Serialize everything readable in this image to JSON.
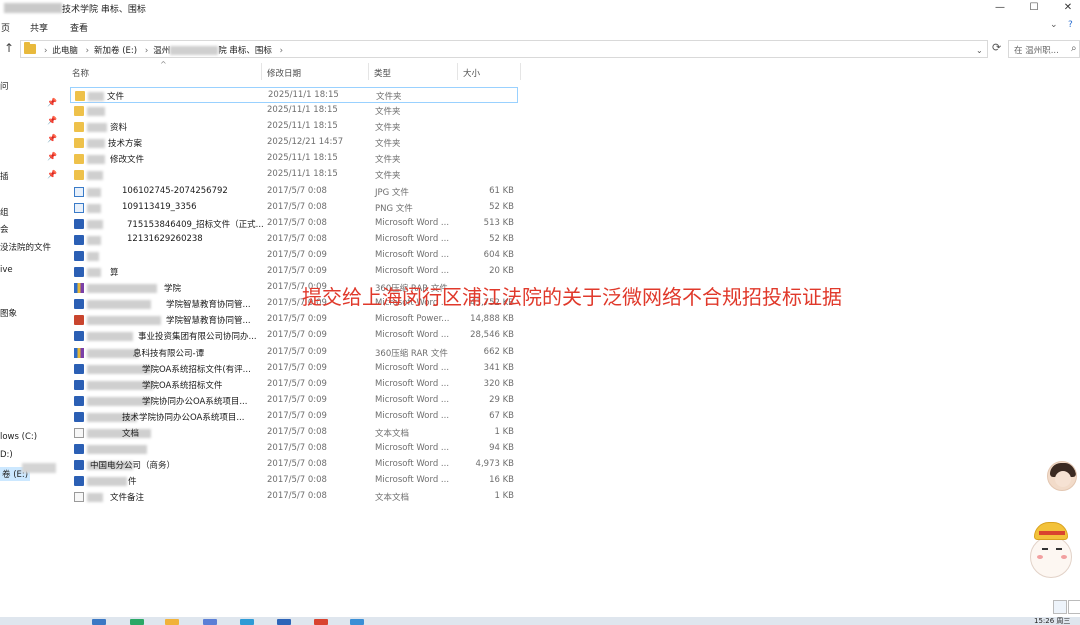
{
  "window": {
    "title": "技术学院 串标、围标",
    "controls": [
      "—",
      "☐",
      "✕"
    ]
  },
  "ribbon": {
    "tabs": [
      "页",
      "共享",
      "查看"
    ]
  },
  "address": {
    "crumbs": [
      "此电脑",
      "新加卷 (E:)",
      "温州",
      "院 串标、围标"
    ],
    "search_placeholder": "在 温州职..."
  },
  "nav": {
    "items": [
      "问",
      "插",
      "组",
      "会",
      "没法院的文件",
      "ive",
      "图象",
      "lows (C:)",
      "D:)",
      "卷 (E:)"
    ]
  },
  "columns": {
    "name": "名称",
    "date": "修改日期",
    "type": "类型",
    "size": "大小"
  },
  "files": [
    {
      "icon": "folder",
      "name": "文件",
      "date": "2025/11/1 18:15",
      "type": "文件夹",
      "size": "",
      "selected": true
    },
    {
      "icon": "folder",
      "name": "",
      "date": "2025/11/1 18:15",
      "type": "文件夹",
      "size": ""
    },
    {
      "icon": "folder",
      "name": "资料",
      "date": "2025/11/1 18:15",
      "type": "文件夹",
      "size": ""
    },
    {
      "icon": "folder",
      "name": "技术方案",
      "date": "2025/12/21 14:57",
      "type": "文件夹",
      "size": ""
    },
    {
      "icon": "folder",
      "name": "修改文件",
      "date": "2025/11/1 18:15",
      "type": "文件夹",
      "size": ""
    },
    {
      "icon": "folder",
      "name": "",
      "date": "2025/11/1 18:15",
      "type": "文件夹",
      "size": ""
    },
    {
      "icon": "img",
      "name": "106102745-2074256792",
      "date": "2017/5/7 0:08",
      "type": "JPG 文件",
      "size": "61 KB"
    },
    {
      "icon": "img",
      "name": "109113419_3356",
      "date": "2017/5/7 0:08",
      "type": "PNG 文件",
      "size": "52 KB"
    },
    {
      "icon": "word",
      "name": "71515384​6409_招标文件（正式...",
      "date": "2017/5/7 0:08",
      "type": "Microsoft Word ...",
      "size": "513 KB"
    },
    {
      "icon": "word",
      "name": "12131629260238",
      "date": "2017/5/7 0:08",
      "type": "Microsoft Word ...",
      "size": "52 KB"
    },
    {
      "icon": "word",
      "name": "",
      "date": "2017/5/7 0:09",
      "type": "Microsoft Word ...",
      "size": "604 KB"
    },
    {
      "icon": "word",
      "name": "算",
      "date": "2017/5/7 0:09",
      "type": "Microsoft Word ...",
      "size": "20 KB"
    },
    {
      "icon": "rar",
      "name": "学院",
      "date": "2017/5/7 0:09",
      "type": "360压缩 RAR 文件",
      "size": ""
    },
    {
      "icon": "word",
      "name": "学院智慧教育协同管...",
      "date": "2017/5/7 0:09",
      "type": "Microsoft Word ...",
      "size": "43,752 KB"
    },
    {
      "icon": "ppt",
      "name": "学院智慧教育协同管...",
      "date": "2017/5/7 0:09",
      "type": "Microsoft Power...",
      "size": "14,888 KB"
    },
    {
      "icon": "word",
      "name": "事业投资集团有限公司协同办...",
      "date": "2017/5/7 0:09",
      "type": "Microsoft Word ...",
      "size": "28,546 KB"
    },
    {
      "icon": "rar",
      "name": "息科技有限公司-谭",
      "date": "2017/5/7 0:09",
      "type": "360压缩 RAR 文件",
      "size": "662 KB"
    },
    {
      "icon": "word",
      "name": "学院OA系统招标文件(有评...",
      "date": "2017/5/7 0:09",
      "type": "Microsoft Word ...",
      "size": "341 KB"
    },
    {
      "icon": "word",
      "name": "学院OA系统招标文件",
      "date": "2017/5/7 0:09",
      "type": "Microsoft Word ...",
      "size": "320 KB"
    },
    {
      "icon": "word",
      "name": "学院协同办公OA系统项目...",
      "date": "2017/5/7 0:09",
      "type": "Microsoft Word ...",
      "size": "29 KB"
    },
    {
      "icon": "word",
      "name": "技术学院协同办公OA系统项目...",
      "date": "2017/5/7 0:09",
      "type": "Microsoft Word ...",
      "size": "67 KB"
    },
    {
      "icon": "txt",
      "name": "文档",
      "date": "2017/5/7 0:08",
      "type": "文本文档",
      "size": "1 KB"
    },
    {
      "icon": "word",
      "name": "",
      "date": "2017/5/7 0:08",
      "type": "Microsoft Word ...",
      "size": "94 KB"
    },
    {
      "icon": "word",
      "name": "中国电分公司（商务）",
      "date": "2017/5/7 0:08",
      "type": "Microsoft Word ...",
      "size": "4,973 KB"
    },
    {
      "icon": "word",
      "name": "件",
      "date": "2017/5/7 0:08",
      "type": "Microsoft Word ...",
      "size": "16 KB"
    },
    {
      "icon": "txt",
      "name": "文件备注",
      "date": "2017/5/7 0:08",
      "type": "文本文档",
      "size": "1 KB"
    }
  ],
  "overlay_caption": "提交给上海闵行区浦江法院的关于泛微网络不合规招投标证据",
  "clock": "15:26 周三"
}
